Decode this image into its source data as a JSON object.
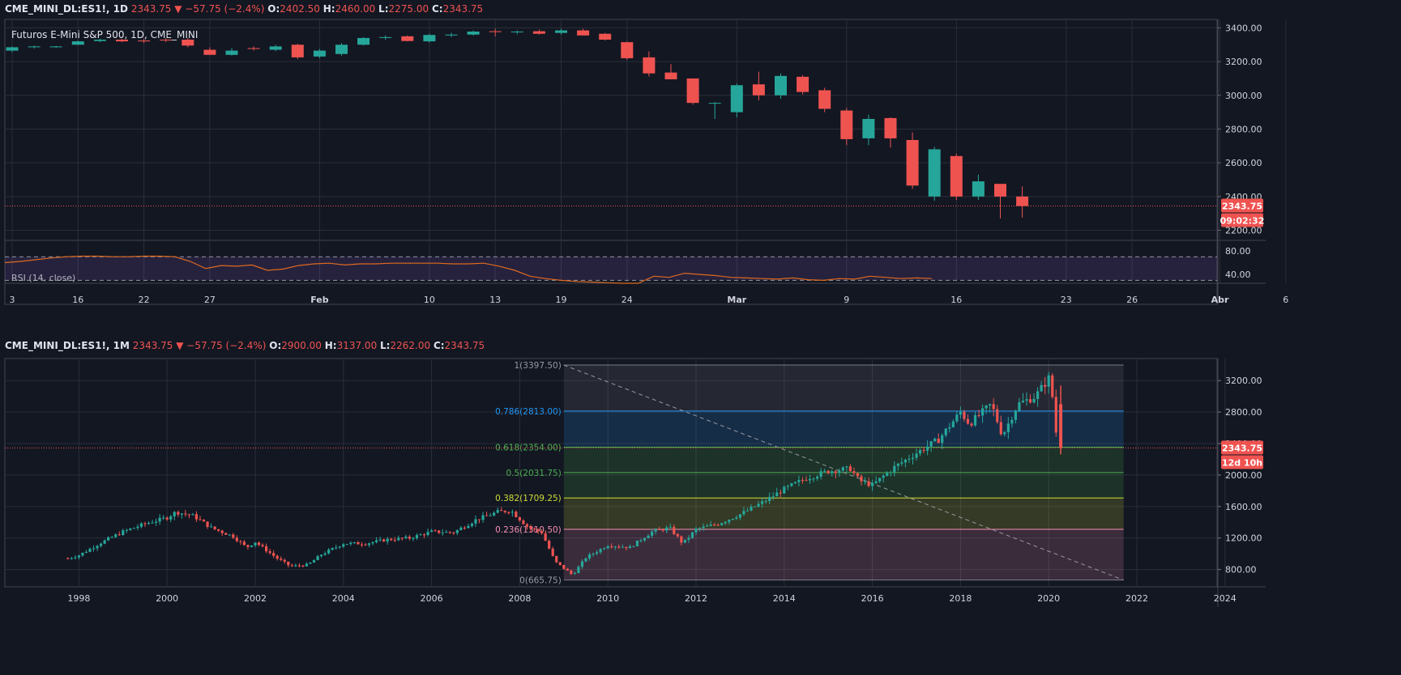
{
  "top_panel": {
    "header": {
      "symbol": "CME_MINI_DL:ES1!, 1D",
      "last": "2343.75",
      "arrow": "▼",
      "change": "−57.75 (−2.4%)",
      "o_label": "O:",
      "o": "2402.50",
      "h_label": "H:",
      "h": "2460.00",
      "l_label": "L:",
      "l": "2275.00",
      "c_label": "C:",
      "c": "2343.75"
    },
    "title": "Futuros E-Mini S&P 500, 1D, CME_MINI",
    "price_badge": "2343.75",
    "countdown_badge": "09:02:32",
    "rsi_title": "RSI (14, close)"
  },
  "bottom_panel": {
    "header": {
      "symbol": "CME_MINI_DL:ES1!, 1M",
      "last": "2343.75",
      "arrow": "▼",
      "change": "−57.75 (−2.4%)",
      "o_label": "O:",
      "o": "2900.00",
      "h_label": "H:",
      "h": "3137.00",
      "l_label": "L:",
      "l": "2262.00",
      "c_label": "C:",
      "c": "2343.75"
    },
    "price_badge": "2343.75",
    "countdown_badge": "12d 10h"
  },
  "colors": {
    "background": "#131722",
    "up": "#26a69a",
    "down": "#ef5350",
    "grid": "#2a2e39",
    "rsi": "#e0691e",
    "rsi_band": "#7e57c2"
  },
  "chart_data": [
    {
      "type": "candlestick",
      "timeframe": "1D",
      "y_ticks": [
        "3400.00",
        "3200.00",
        "3000.00",
        "2800.00",
        "2600.00",
        "2400.00",
        "2200.00"
      ],
      "ylim": [
        2140,
        3450
      ],
      "x_ticks": [
        {
          "label": "3",
          "i": 0
        },
        {
          "label": "16",
          "i": 3
        },
        {
          "label": "22",
          "i": 6
        },
        {
          "label": "27",
          "i": 9
        },
        {
          "label": "Feb",
          "i": 14
        },
        {
          "label": "10",
          "i": 19
        },
        {
          "label": "13",
          "i": 22
        },
        {
          "label": "19",
          "i": 25
        },
        {
          "label": "24",
          "i": 28
        },
        {
          "label": "Mar",
          "i": 33
        },
        {
          "label": "9",
          "i": 38
        },
        {
          "label": "16",
          "i": 43
        },
        {
          "label": "23",
          "i": 48
        },
        {
          "label": "26",
          "i": 51
        },
        {
          "label": "Abr",
          "i": 55
        },
        {
          "label": "6",
          "i": 58
        }
      ],
      "last_price": 2343.75,
      "candles": [
        [
          3265,
          3290,
          3255,
          3285
        ],
        [
          3285,
          3295,
          3278,
          3290
        ],
        [
          3285,
          3293,
          3280,
          3290
        ],
        [
          3300,
          3325,
          3298,
          3320
        ],
        [
          3322,
          3335,
          3315,
          3330
        ],
        [
          3330,
          3335,
          3315,
          3320
        ],
        [
          3325,
          3335,
          3310,
          3320
        ],
        [
          3330,
          3338,
          3315,
          3325
        ],
        [
          3330,
          3340,
          3285,
          3295
        ],
        [
          3270,
          3285,
          3245,
          3240
        ],
        [
          3240,
          3280,
          3235,
          3265
        ],
        [
          3280,
          3290,
          3265,
          3275
        ],
        [
          3270,
          3300,
          3262,
          3290
        ],
        [
          3300,
          3305,
          3215,
          3225
        ],
        [
          3230,
          3275,
          3220,
          3265
        ],
        [
          3245,
          3310,
          3235,
          3300
        ],
        [
          3300,
          3345,
          3295,
          3340
        ],
        [
          3340,
          3355,
          3330,
          3345
        ],
        [
          3350,
          3355,
          3320,
          3322
        ],
        [
          3320,
          3365,
          3312,
          3358
        ],
        [
          3355,
          3370,
          3345,
          3360
        ],
        [
          3360,
          3385,
          3355,
          3378
        ],
        [
          3380,
          3395,
          3350,
          3375
        ],
        [
          3375,
          3385,
          3362,
          3378
        ],
        [
          3380,
          3390,
          3360,
          3365
        ],
        [
          3370,
          3395,
          3360,
          3385
        ],
        [
          3385,
          3395,
          3355,
          3355
        ],
        [
          3365,
          3370,
          3325,
          3330
        ],
        [
          3315,
          3320,
          3210,
          3220
        ],
        [
          3225,
          3260,
          3112,
          3130
        ],
        [
          3135,
          3185,
          3095,
          3095
        ],
        [
          3100,
          3100,
          2945,
          2955
        ],
        [
          2955,
          2960,
          2860,
          2955
        ],
        [
          2900,
          3070,
          2870,
          3060
        ],
        [
          3065,
          3140,
          2970,
          3000
        ],
        [
          3000,
          3130,
          2980,
          3115
        ],
        [
          3110,
          3120,
          3005,
          3020
        ],
        [
          3030,
          3045,
          2900,
          2920
        ],
        [
          2910,
          2925,
          2705,
          2740
        ],
        [
          2745,
          2885,
          2705,
          2860
        ],
        [
          2865,
          2870,
          2690,
          2745
        ],
        [
          2735,
          2780,
          2445,
          2465
        ],
        [
          2400,
          2695,
          2375,
          2680
        ],
        [
          2640,
          2655,
          2380,
          2400
        ],
        [
          2400,
          2530,
          2380,
          2490
        ],
        [
          2475,
          2475,
          2270,
          2400
        ],
        [
          2400,
          2460,
          2275,
          2343.75
        ]
      ],
      "rsi": {
        "ylim": [
          25,
          95
        ],
        "y_ticks": [
          "80.00",
          "40.00"
        ],
        "band": [
          30,
          70
        ],
        "values": [
          60,
          62,
          65,
          68,
          70,
          71,
          71,
          70,
          70,
          71,
          71,
          70,
          62,
          50,
          55,
          54,
          56,
          47,
          49,
          55,
          58,
          59,
          56,
          58,
          58,
          59,
          59,
          59,
          59,
          58,
          58,
          59,
          54,
          47,
          37,
          33,
          30,
          28,
          27,
          26,
          25,
          25,
          37,
          35,
          42,
          40,
          38,
          35,
          34,
          33,
          32,
          34,
          31,
          30,
          33,
          32,
          37,
          35,
          33,
          34,
          33
        ]
      }
    },
    {
      "type": "candlestick",
      "timeframe": "1M",
      "y_ticks": [
        "3200.00",
        "2800.00",
        "2400.00",
        "2000.00",
        "1600.00",
        "1200.00",
        "800.00"
      ],
      "ylim": [
        580,
        3480
      ],
      "x_ticks": [
        "1998",
        "2000",
        "2002",
        "2004",
        "2006",
        "2008",
        "2010",
        "2012",
        "2014",
        "2016",
        "2018",
        "2020",
        "2022",
        "2024"
      ],
      "last_price": 2343.75,
      "series_year_close": [
        [
          1997.75,
          940
        ],
        [
          1998.0,
          980
        ],
        [
          1998.5,
          1140
        ],
        [
          1999.0,
          1280
        ],
        [
          1999.5,
          1380
        ],
        [
          2000.0,
          1460
        ],
        [
          2000.2,
          1530
        ],
        [
          2000.6,
          1480
        ],
        [
          2001.0,
          1330
        ],
        [
          2001.5,
          1220
        ],
        [
          2001.8,
          1080
        ],
        [
          2002.0,
          1150
        ],
        [
          2002.5,
          940
        ],
        [
          2002.8,
          840
        ],
        [
          2003.2,
          860
        ],
        [
          2003.5,
          990
        ],
        [
          2004.0,
          1130
        ],
        [
          2004.5,
          1130
        ],
        [
          2005.0,
          1180
        ],
        [
          2005.5,
          1200
        ],
        [
          2006.0,
          1280
        ],
        [
          2006.5,
          1270
        ],
        [
          2007.0,
          1430
        ],
        [
          2007.5,
          1530
        ],
        [
          2007.8,
          1550
        ],
        [
          2008.2,
          1330
        ],
        [
          2008.5,
          1270
        ],
        [
          2008.8,
          900
        ],
        [
          2009.2,
          730
        ],
        [
          2009.5,
          950
        ],
        [
          2010.0,
          1110
        ],
        [
          2010.5,
          1080
        ],
        [
          2011.0,
          1280
        ],
        [
          2011.4,
          1330
        ],
        [
          2011.7,
          1130
        ],
        [
          2012.0,
          1310
        ],
        [
          2012.5,
          1380
        ],
        [
          2013.0,
          1500
        ],
        [
          2013.5,
          1650
        ],
        [
          2014.0,
          1820
        ],
        [
          2014.5,
          1960
        ],
        [
          2015.0,
          2050
        ],
        [
          2015.5,
          2080
        ],
        [
          2015.7,
          1930
        ],
        [
          2016.0,
          1870
        ],
        [
          2016.5,
          2100
        ],
        [
          2017.0,
          2280
        ],
        [
          2017.5,
          2450
        ],
        [
          2018.0,
          2800
        ],
        [
          2018.2,
          2650
        ],
        [
          2018.7,
          2900
        ],
        [
          2018.95,
          2500
        ],
        [
          2019.3,
          2900
        ],
        [
          2019.7,
          3000
        ],
        [
          2020.0,
          3230
        ],
        [
          2020.1,
          2950
        ],
        [
          2020.2,
          2343.75
        ]
      ],
      "fibonacci": {
        "levels": [
          {
            "label": "1(3397.50)",
            "ratio": 1,
            "price": 3397.5
          },
          {
            "label": "0.786(2813.00)",
            "ratio": 0.786,
            "price": 2813.0
          },
          {
            "label": "0.618(2354.00)",
            "ratio": 0.618,
            "price": 2354.0
          },
          {
            "label": "0.5(2031.75)",
            "ratio": 0.5,
            "price": 2031.75
          },
          {
            "label": "0.382(1709.25)",
            "ratio": 0.382,
            "price": 1709.25
          },
          {
            "label": "0.236(1310.50)",
            "ratio": 0.236,
            "price": 1310.5
          },
          {
            "label": "0(665.75)",
            "ratio": 0,
            "price": 665.75
          }
        ],
        "x_start": 2009.0,
        "x_end": 2021.7,
        "level_colors": [
          "#787b86",
          "#2196f3",
          "#4caf50",
          "#4caf50",
          "#cddc39",
          "#f48fb1",
          "#787b86"
        ]
      }
    }
  ]
}
